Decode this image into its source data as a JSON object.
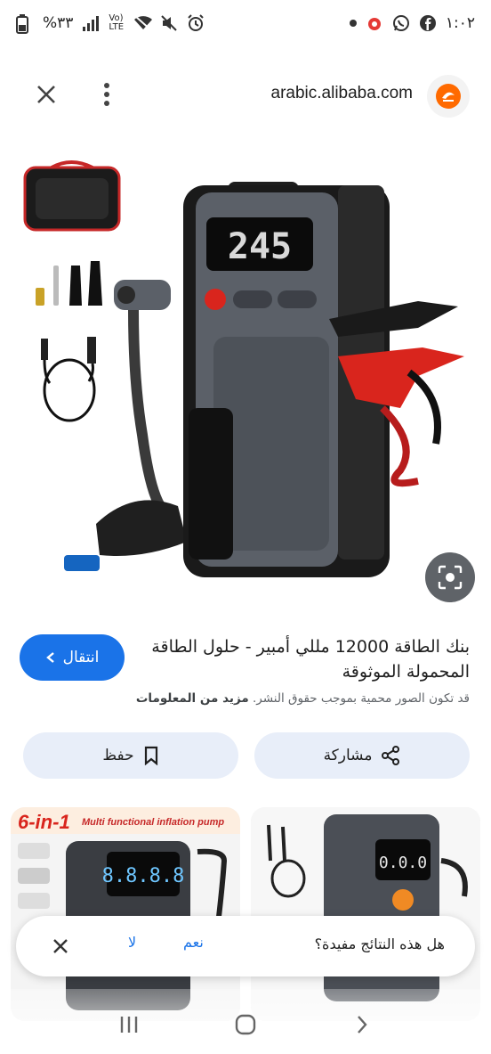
{
  "status_bar": {
    "time": "١:٠٢",
    "battery": "%٣٣",
    "network": "Vo) LTE"
  },
  "header": {
    "domain": "arabic.alibaba.com"
  },
  "result": {
    "title": "بنك الطاقة 12000 مللي أمبير - حلول الطاقة المحمولة الموثوقة",
    "visit_label": "انتقال",
    "copyright_text": "قد تكون الصور محمية بموجب حقوق النشر.",
    "more_info": "مزيد من المعلومات"
  },
  "actions": {
    "share_label": "مشاركة",
    "save_label": "حفظ"
  },
  "related": {
    "left_banner": "6-in-1",
    "left_banner_sub": "Multi functional inflation pump",
    "left_display": "8.8.8.8",
    "right_display": "0.0.0"
  },
  "feedback": {
    "question": "هل هذه النتائج مفيدة؟",
    "yes": "نعم",
    "no": "لا"
  },
  "product_display": "245",
  "colors": {
    "accent": "#1a73e8",
    "button_bg": "#e8eef9",
    "device_body": "#5b6068",
    "clamp_red": "#d9251d"
  }
}
